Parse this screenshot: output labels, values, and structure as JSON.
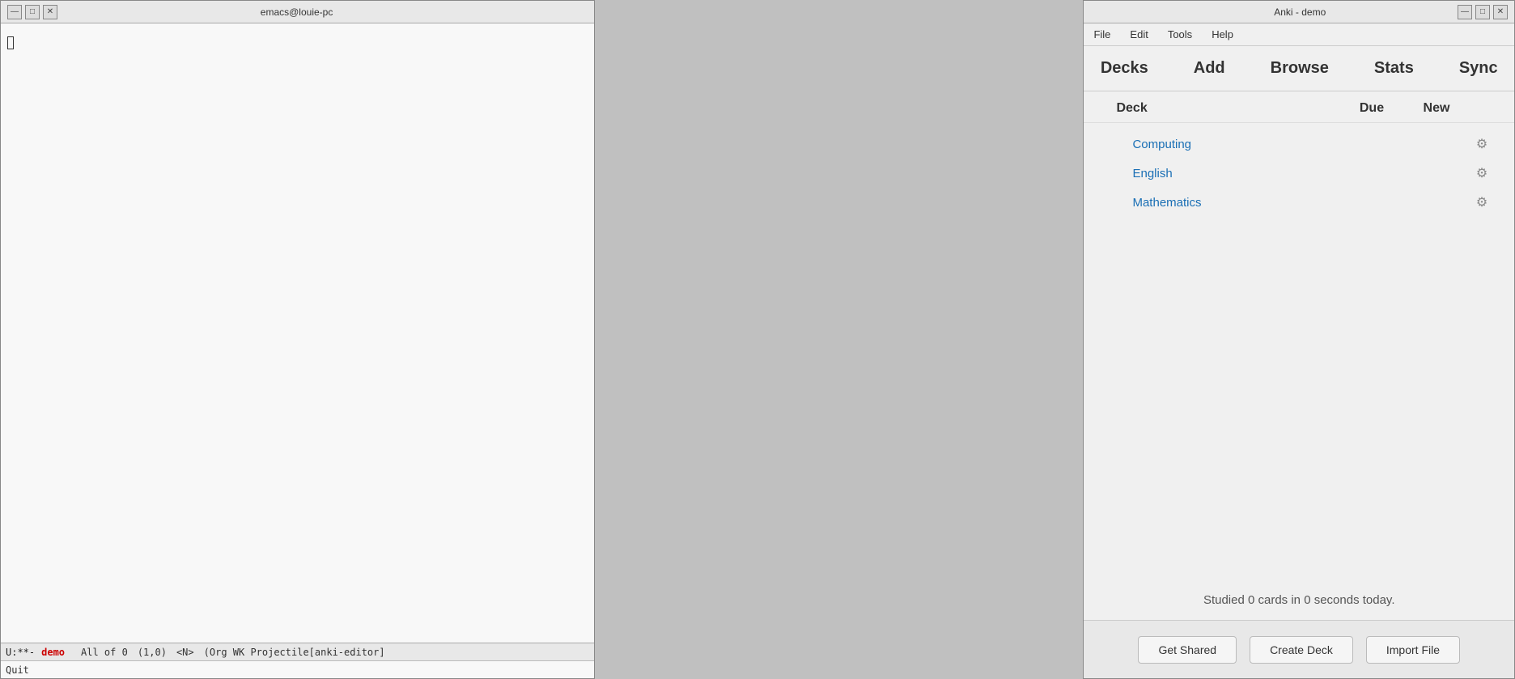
{
  "emacs": {
    "title": "emacs@louie-pc",
    "controls": {
      "minimize": "—",
      "maximize": "□",
      "close": "✕"
    },
    "statusbar": {
      "mode": "U:**-",
      "buffer": "demo",
      "position": "All of 0",
      "line_col": "(1,0)",
      "mode_name": "<N>",
      "major_mode": "(Org WK Projectile[anki-editor]"
    },
    "minibuffer": "Quit"
  },
  "anki": {
    "title": "Anki - demo",
    "controls": {
      "minimize": "—",
      "maximize": "□",
      "close": "✕"
    },
    "menu": {
      "file": "File",
      "edit": "Edit",
      "tools": "Tools",
      "help": "Help"
    },
    "toolbar": {
      "decks": "Decks",
      "add": "Add",
      "browse": "Browse",
      "stats": "Stats",
      "sync": "Sync"
    },
    "deck_list": {
      "header": {
        "deck": "Deck",
        "due": "Due",
        "new": "New"
      },
      "decks": [
        {
          "name": "Computing",
          "due": "",
          "new": ""
        },
        {
          "name": "English",
          "due": "",
          "new": ""
        },
        {
          "name": "Mathematics",
          "due": "",
          "new": ""
        }
      ]
    },
    "studied_text": "Studied 0 cards in 0 seconds today.",
    "footer": {
      "get_shared": "Get Shared",
      "create_deck": "Create Deck",
      "import_file": "Import File"
    }
  }
}
